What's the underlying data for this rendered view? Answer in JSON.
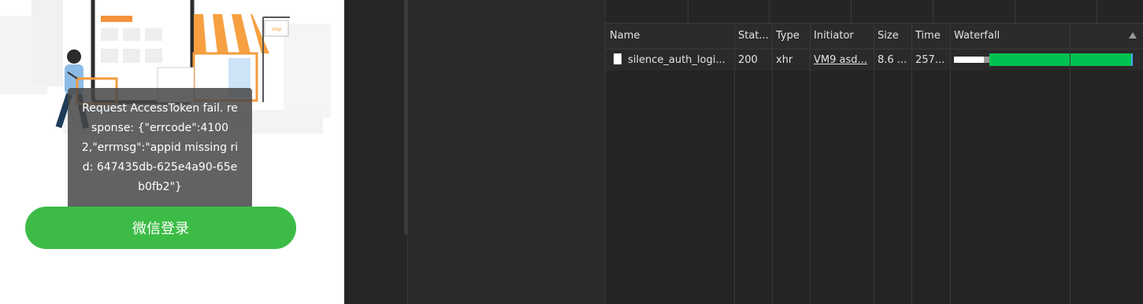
{
  "mobile": {
    "toast_message": "Request AccessToken fail. response: {\"errcode\":41002,\"errmsg\":\"appid missing rid: 647435db-625e4a90-65eb0fb2\"}",
    "login_button": "微信登录",
    "accent": "#3cbc46",
    "illustration": {
      "icon": "store-illustration-icon",
      "sign_text": "shop"
    }
  },
  "network": {
    "columns": [
      "Name",
      "Stat...",
      "Type",
      "Initiator",
      "Size",
      "Time",
      "Waterfall"
    ],
    "rows": [
      {
        "name": "silence_auth_logi...",
        "status": "200",
        "type": "xhr",
        "initiator": "VM9 asd...",
        "size": "8.6 ...",
        "time": "257..."
      }
    ],
    "waterfall_colors": {
      "download": "#00c250",
      "waiting": "#ffffff",
      "queue": "#9a9a9a"
    }
  }
}
